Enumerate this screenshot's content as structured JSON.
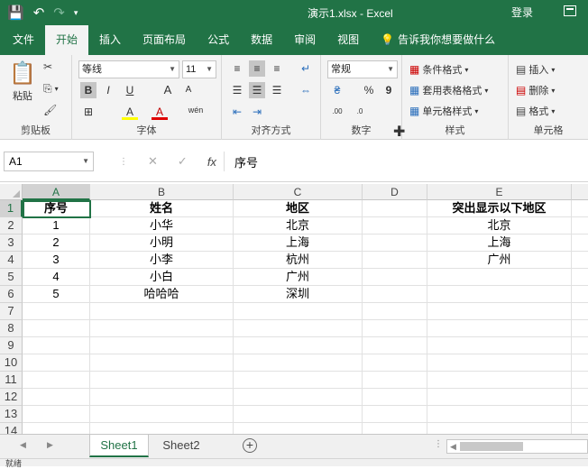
{
  "titlebar": {
    "filename": "演示1.xlsx",
    "sep": "-",
    "app": "Excel",
    "login": "登录"
  },
  "tabs": [
    "文件",
    "开始",
    "插入",
    "页面布局",
    "公式",
    "数据",
    "审阅",
    "视图"
  ],
  "tellme": "告诉我你想要做什么",
  "ribbon": {
    "clipboard": {
      "paste": "粘贴",
      "label": "剪贴板"
    },
    "font": {
      "name": "等线",
      "size": "11",
      "label": "字体",
      "bold": "B",
      "italic": "I",
      "underline": "U",
      "grow": "A",
      "shrink": "A",
      "fill": "A",
      "color": "A",
      "phonetic": "wén"
    },
    "alignment": {
      "label": "对齐方式"
    },
    "number": {
      "format": "常规",
      "label": "数字",
      "percent": "%",
      "comma": "9"
    },
    "styles": {
      "conditional": "条件格式",
      "table": "套用表格格式",
      "cell": "单元格样式",
      "label": "样式"
    },
    "cells": {
      "insert": "插入",
      "delete": "删除",
      "format": "格式",
      "label": "单元格"
    }
  },
  "formula_bar": {
    "name_box": "A1",
    "fx": "fx",
    "content": "序号"
  },
  "columns": [
    "A",
    "B",
    "C",
    "D",
    "E"
  ],
  "rows": [
    "1",
    "2",
    "3",
    "4",
    "5",
    "6",
    "7",
    "8",
    "9",
    "10",
    "11",
    "12",
    "13",
    "14"
  ],
  "cells": {
    "r1": [
      "序号",
      "姓名",
      "地区",
      "",
      "突出显示以下地区"
    ],
    "r2": [
      "1",
      "小华",
      "北京",
      "",
      "北京"
    ],
    "r3": [
      "2",
      "小明",
      "上海",
      "",
      "上海"
    ],
    "r4": [
      "3",
      "小李",
      "杭州",
      "",
      "广州"
    ],
    "r5": [
      "4",
      "小白",
      "广州",
      "",
      ""
    ],
    "r6": [
      "5",
      "哈哈哈",
      "深圳",
      "",
      ""
    ]
  },
  "sheets": [
    "Sheet1",
    "Sheet2"
  ],
  "status": "就绪"
}
